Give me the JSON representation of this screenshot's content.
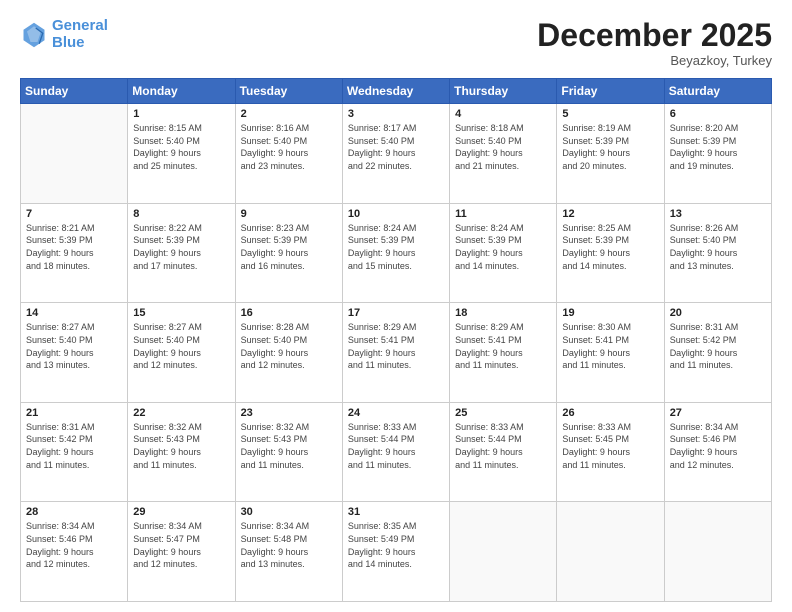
{
  "header": {
    "logo_line1": "General",
    "logo_line2": "Blue",
    "month": "December 2025",
    "location": "Beyazkoy, Turkey"
  },
  "weekdays": [
    "Sunday",
    "Monday",
    "Tuesday",
    "Wednesday",
    "Thursday",
    "Friday",
    "Saturday"
  ],
  "weeks": [
    [
      {
        "day": "",
        "info": ""
      },
      {
        "day": "1",
        "info": "Sunrise: 8:15 AM\nSunset: 5:40 PM\nDaylight: 9 hours\nand 25 minutes."
      },
      {
        "day": "2",
        "info": "Sunrise: 8:16 AM\nSunset: 5:40 PM\nDaylight: 9 hours\nand 23 minutes."
      },
      {
        "day": "3",
        "info": "Sunrise: 8:17 AM\nSunset: 5:40 PM\nDaylight: 9 hours\nand 22 minutes."
      },
      {
        "day": "4",
        "info": "Sunrise: 8:18 AM\nSunset: 5:40 PM\nDaylight: 9 hours\nand 21 minutes."
      },
      {
        "day": "5",
        "info": "Sunrise: 8:19 AM\nSunset: 5:39 PM\nDaylight: 9 hours\nand 20 minutes."
      },
      {
        "day": "6",
        "info": "Sunrise: 8:20 AM\nSunset: 5:39 PM\nDaylight: 9 hours\nand 19 minutes."
      }
    ],
    [
      {
        "day": "7",
        "info": "Sunrise: 8:21 AM\nSunset: 5:39 PM\nDaylight: 9 hours\nand 18 minutes."
      },
      {
        "day": "8",
        "info": "Sunrise: 8:22 AM\nSunset: 5:39 PM\nDaylight: 9 hours\nand 17 minutes."
      },
      {
        "day": "9",
        "info": "Sunrise: 8:23 AM\nSunset: 5:39 PM\nDaylight: 9 hours\nand 16 minutes."
      },
      {
        "day": "10",
        "info": "Sunrise: 8:24 AM\nSunset: 5:39 PM\nDaylight: 9 hours\nand 15 minutes."
      },
      {
        "day": "11",
        "info": "Sunrise: 8:24 AM\nSunset: 5:39 PM\nDaylight: 9 hours\nand 14 minutes."
      },
      {
        "day": "12",
        "info": "Sunrise: 8:25 AM\nSunset: 5:39 PM\nDaylight: 9 hours\nand 14 minutes."
      },
      {
        "day": "13",
        "info": "Sunrise: 8:26 AM\nSunset: 5:40 PM\nDaylight: 9 hours\nand 13 minutes."
      }
    ],
    [
      {
        "day": "14",
        "info": "Sunrise: 8:27 AM\nSunset: 5:40 PM\nDaylight: 9 hours\nand 13 minutes."
      },
      {
        "day": "15",
        "info": "Sunrise: 8:27 AM\nSunset: 5:40 PM\nDaylight: 9 hours\nand 12 minutes."
      },
      {
        "day": "16",
        "info": "Sunrise: 8:28 AM\nSunset: 5:40 PM\nDaylight: 9 hours\nand 12 minutes."
      },
      {
        "day": "17",
        "info": "Sunrise: 8:29 AM\nSunset: 5:41 PM\nDaylight: 9 hours\nand 11 minutes."
      },
      {
        "day": "18",
        "info": "Sunrise: 8:29 AM\nSunset: 5:41 PM\nDaylight: 9 hours\nand 11 minutes."
      },
      {
        "day": "19",
        "info": "Sunrise: 8:30 AM\nSunset: 5:41 PM\nDaylight: 9 hours\nand 11 minutes."
      },
      {
        "day": "20",
        "info": "Sunrise: 8:31 AM\nSunset: 5:42 PM\nDaylight: 9 hours\nand 11 minutes."
      }
    ],
    [
      {
        "day": "21",
        "info": "Sunrise: 8:31 AM\nSunset: 5:42 PM\nDaylight: 9 hours\nand 11 minutes."
      },
      {
        "day": "22",
        "info": "Sunrise: 8:32 AM\nSunset: 5:43 PM\nDaylight: 9 hours\nand 11 minutes."
      },
      {
        "day": "23",
        "info": "Sunrise: 8:32 AM\nSunset: 5:43 PM\nDaylight: 9 hours\nand 11 minutes."
      },
      {
        "day": "24",
        "info": "Sunrise: 8:33 AM\nSunset: 5:44 PM\nDaylight: 9 hours\nand 11 minutes."
      },
      {
        "day": "25",
        "info": "Sunrise: 8:33 AM\nSunset: 5:44 PM\nDaylight: 9 hours\nand 11 minutes."
      },
      {
        "day": "26",
        "info": "Sunrise: 8:33 AM\nSunset: 5:45 PM\nDaylight: 9 hours\nand 11 minutes."
      },
      {
        "day": "27",
        "info": "Sunrise: 8:34 AM\nSunset: 5:46 PM\nDaylight: 9 hours\nand 12 minutes."
      }
    ],
    [
      {
        "day": "28",
        "info": "Sunrise: 8:34 AM\nSunset: 5:46 PM\nDaylight: 9 hours\nand 12 minutes."
      },
      {
        "day": "29",
        "info": "Sunrise: 8:34 AM\nSunset: 5:47 PM\nDaylight: 9 hours\nand 12 minutes."
      },
      {
        "day": "30",
        "info": "Sunrise: 8:34 AM\nSunset: 5:48 PM\nDaylight: 9 hours\nand 13 minutes."
      },
      {
        "day": "31",
        "info": "Sunrise: 8:35 AM\nSunset: 5:49 PM\nDaylight: 9 hours\nand 14 minutes."
      },
      {
        "day": "",
        "info": ""
      },
      {
        "day": "",
        "info": ""
      },
      {
        "day": "",
        "info": ""
      }
    ]
  ]
}
